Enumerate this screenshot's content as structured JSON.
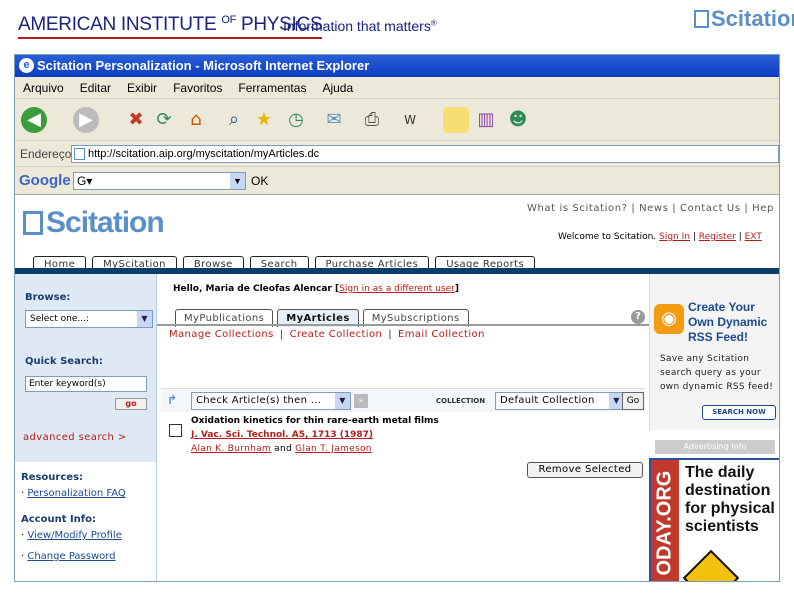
{
  "slide": {
    "aip_logo_main": "AMERICAN INSTITUTE",
    "aip_logo_of": "OF",
    "aip_logo_end": "PHYSICS",
    "tagline": "Information that matters",
    "tagline_mark": "®",
    "scitation_brand": "Scitation"
  },
  "browser": {
    "title": "Scitation Personalization - Microsoft Internet Explorer",
    "menu": [
      "Arquivo",
      "Editar",
      "Exibir",
      "Favoritos",
      "Ferramentas",
      "Ajuda"
    ],
    "address_label": "Endereço",
    "address_url": "http://scitation.aip.org/myscitation/myArticles.dc",
    "google_label": "Google",
    "google_combo": "G▾",
    "google_ok": "OK",
    "toolbar_icons": [
      "back-icon",
      "forward-icon",
      "stop-icon",
      "refresh-icon",
      "home-icon",
      "search-icon",
      "favorites-icon",
      "history-icon",
      "mail-icon",
      "print-icon",
      "edit-icon",
      "note-icon",
      "research-icon",
      "messenger-icon"
    ]
  },
  "page": {
    "logo": "Scitation",
    "toplinks": "What is Scitation? | News | Contact Us | Hep",
    "welcome_prefix": "Welcome to Scitation.",
    "sign_in": "Sign In",
    "register": "Register",
    "ext": "EXT",
    "sep": "|",
    "nav_tabs": [
      "Home",
      "MyScitation",
      "Browse",
      "Search",
      "Purchase Articles",
      "Usage Reports"
    ]
  },
  "sidebar": {
    "browse_heading": "Browse:",
    "browse_select": "Select one...:",
    "quick_search_heading": "Quick Search:",
    "quick_search_placeholder": "Enter keyword(s)",
    "go_label": "go",
    "advanced_search": "advanced search >",
    "resources_heading": "Resources:",
    "personalization_faq": "Personalization FAQ",
    "account_heading": "Account Info:",
    "view_profile": "View/Modify Profile",
    "change_password": "Change Password"
  },
  "main": {
    "hello": "Hello, Maria de Cleofas Alencar",
    "sign_in_different": "Sign in as a different user",
    "subtabs": [
      "MyPublications",
      "MyArticles",
      "MySubscriptions"
    ],
    "active_subtab": "MyArticles",
    "collection_links": [
      "Manage Collections",
      "Create Collection",
      "Email Collection"
    ],
    "action_select": "Check Article(s) then ...",
    "collection_label": "COLLECTION",
    "collection_select": "Default Collection",
    "go_button": "Go",
    "article": {
      "title": "Oxidation kinetics for thin rare-earth metal films",
      "journal": "J. Vac. Sci. Technol. A5, 1713 (1987)",
      "author1": "Alan K. Burnham",
      "and": "and",
      "author2": "Glan T. Jameson"
    },
    "remove_button": "Remove Selected"
  },
  "rightcol": {
    "rss_title_1": "Create Your",
    "rss_title_2": "Own Dynamic",
    "rss_title_3": "RSS Feed!",
    "rss_text": "Save any Scitation search query as your own dynamic RSS feed!",
    "search_now": "SEARCH NOW",
    "advertising": "Advertising Info",
    "ad_side": "ODAY.ORG",
    "ad_headline": "The daily destination for physical scientists"
  },
  "colors": {
    "titlebar": "#0a3cc2",
    "link_red": "#b71c1c",
    "nav_rule": "#0a3d6b",
    "brand_blue": "#5b8fc7"
  }
}
